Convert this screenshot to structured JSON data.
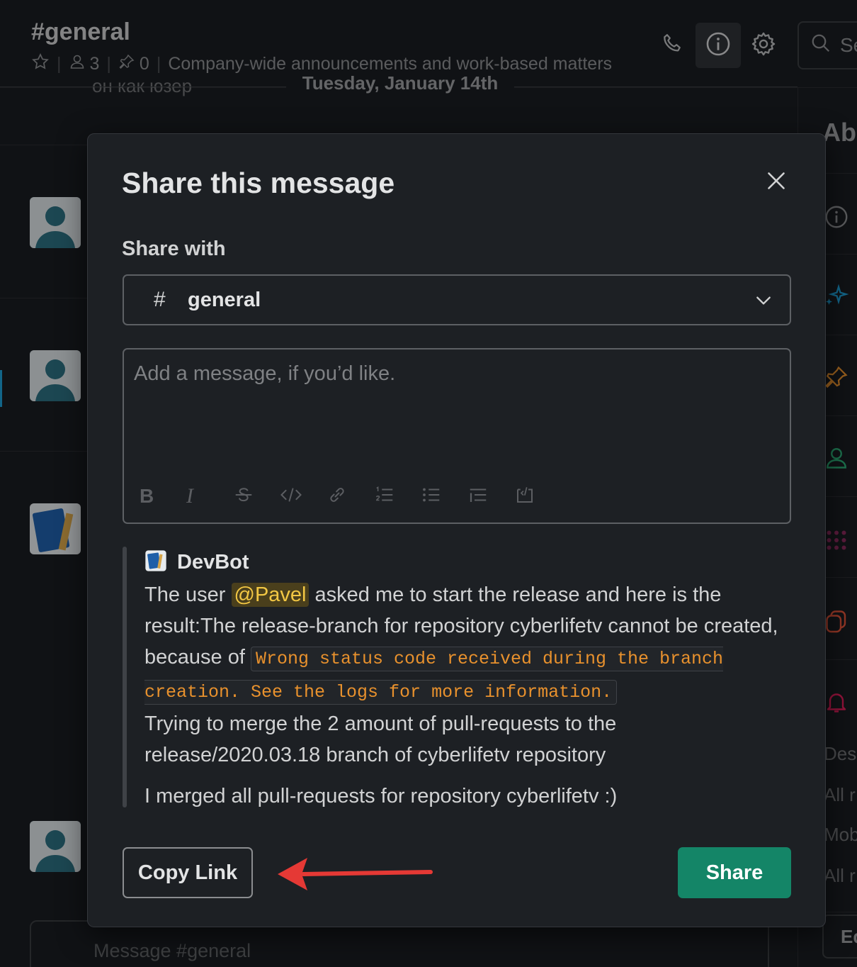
{
  "channel": {
    "name": "#general",
    "members": "3",
    "pins": "0",
    "topic": "Company-wide announcements and work-based matters"
  },
  "header": {
    "search_placeholder": "Se"
  },
  "timeline": {
    "previous_text": "он как юзер",
    "date_divider": "Tuesday, January 14th"
  },
  "right_panel": {
    "title": "Abo",
    "notif_desktop": "Desk",
    "notif_desktop_value": "All r",
    "notif_mobile": "Mob",
    "notif_mobile_value": "All r",
    "edit_button": "Ed"
  },
  "composer": {
    "placeholder": "Message #general"
  },
  "modal": {
    "title": "Share this message",
    "share_with_label": "Share with",
    "selected_channel": {
      "prefix": "#",
      "name": "general"
    },
    "message_placeholder": "Add a message, if you’d like.",
    "quoted": {
      "author": "DevBot",
      "line1_before": "The user ",
      "mention": "@Pavel",
      "line1_after": " asked me to start the release and here is the result:The release-branch for repository cyberlifetv cannot be created, because of ",
      "code": "Wrong status code received during the branch creation. See the logs for more information.",
      "line2": "Trying to merge the 2 amount of pull-requests to the release/2020.03.18 branch  of cyberlifetv repository",
      "line3": "I merged all pull-requests for repository cyberlifetv :)"
    },
    "copy_link_label": "Copy Link",
    "share_label": "Share"
  },
  "colors": {
    "share_button": "#148567",
    "mention_text": "#f2c744",
    "code_text": "#e8912d",
    "annotation_arrow": "#e53935"
  }
}
